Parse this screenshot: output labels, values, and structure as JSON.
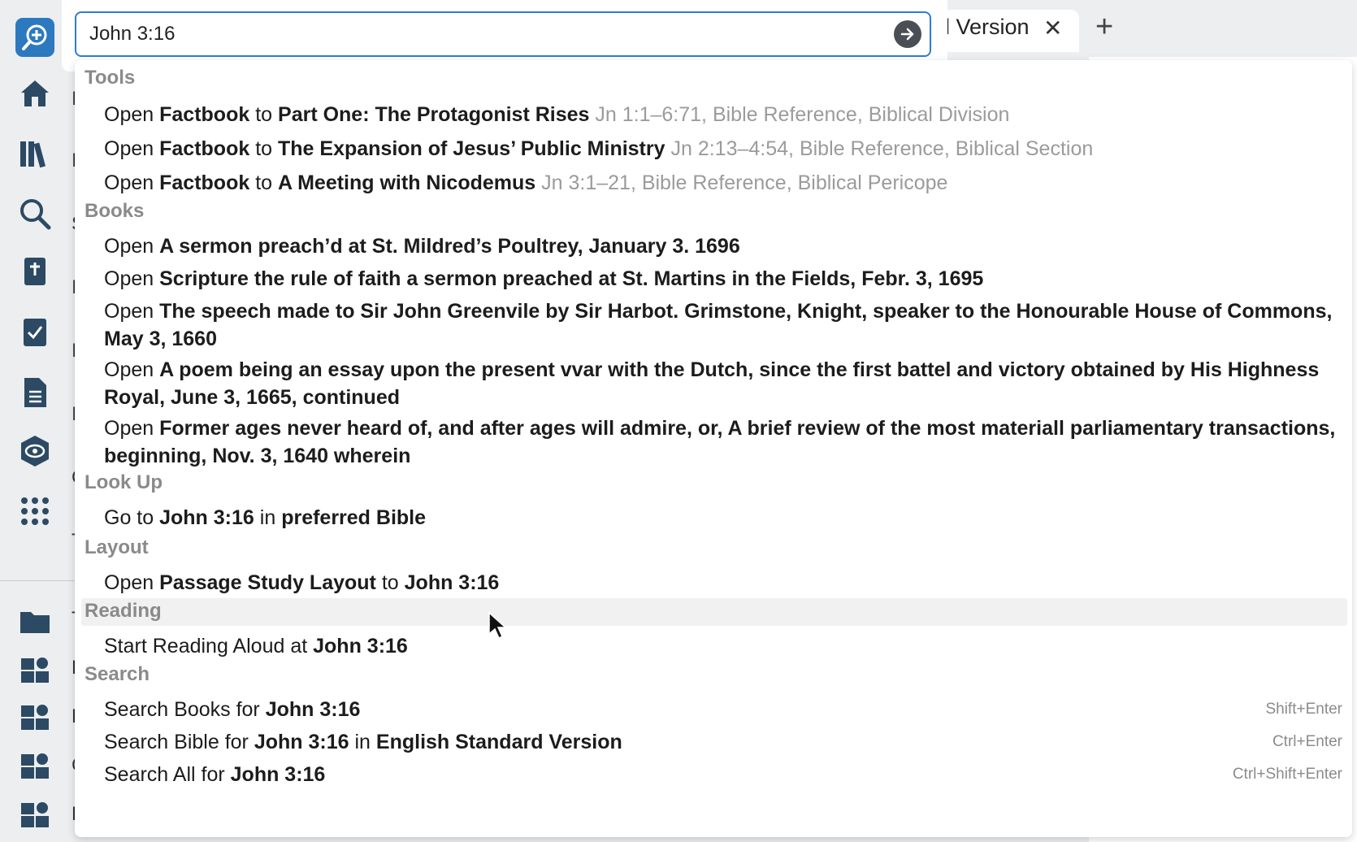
{
  "search": {
    "value": "John 3:16"
  },
  "tab": {
    "title": "l Version",
    "close": "✕",
    "add": "+"
  },
  "sections": {
    "tools": "Tools",
    "books": "Books",
    "lookup": "Look Up",
    "layout": "Layout",
    "reading": "Reading",
    "search": "Search"
  },
  "tools": [
    {
      "verb": "Open",
      "tool": "Factbook",
      "conj": "to",
      "target": "Part One: The Protagonist Rises",
      "meta": "Jn 1:1–6:71, Bible Reference, Biblical Division"
    },
    {
      "verb": "Open",
      "tool": "Factbook",
      "conj": "to",
      "target": "The Expansion of Jesus’ Public Ministry",
      "meta": "Jn 2:13–4:54, Bible Reference, Biblical Section"
    },
    {
      "verb": "Open",
      "tool": "Factbook",
      "conj": "to",
      "target": "A Meeting with Nicodemus",
      "meta": "Jn 3:1–21, Bible Reference, Biblical Pericope"
    }
  ],
  "books": [
    {
      "verb": "Open",
      "title": "A sermon preach’d at St. Mildred’s Poultrey, January 3. 1696"
    },
    {
      "verb": "Open",
      "title": "Scripture the rule of faith a sermon preached at St. Martins in the Fields, Febr. 3, 1695"
    },
    {
      "verb": "Open",
      "title": "The speech made to Sir John Greenvile by Sir Harbot. Grimstone, Knight, speaker to the Honourable House of Commons, May 3, 1660"
    },
    {
      "verb": "Open",
      "title": "A poem being an essay upon the present vvar with the Dutch, since the first battel and victory obtained by His Highness Royal, June 3, 1665, continued"
    },
    {
      "verb": "Open",
      "title": "Former ages never heard of, and after ages will admire, or, A brief review of the most materiall parliamentary transactions, beginning, Nov. 3, 1640 wherein"
    }
  ],
  "lookup": {
    "pre": "Go to",
    "ref": "John 3:16",
    "mid": "in",
    "bible": "preferred Bible"
  },
  "layout": {
    "verb": "Open",
    "name": "Passage Study Layout",
    "conj": "to",
    "ref": "John 3:16"
  },
  "reading": {
    "pre": "Start Reading Aloud at",
    "ref": "John 3:16"
  },
  "search_items": [
    {
      "pre": "Search Books for",
      "ref": "John 3:16",
      "mid": "",
      "version": "",
      "shortcut": "Shift+Enter"
    },
    {
      "pre": "Search Bible for",
      "ref": "John 3:16",
      "mid": "in",
      "version": "English Standard Version",
      "shortcut": "Ctrl+Enter"
    },
    {
      "pre": "Search All for",
      "ref": "John 3:16",
      "mid": "",
      "version": "",
      "shortcut": "Ctrl+Shift+Enter"
    }
  ],
  "rail_letters": [
    "I",
    "I",
    "S",
    "I",
    "I",
    "I",
    "C",
    "T",
    "T",
    "E",
    "E",
    "C",
    "F"
  ],
  "icons": [
    "logo-search-icon",
    "home-icon",
    "library-icon",
    "search-icon",
    "bible-icon",
    "checklist-icon",
    "document-icon",
    "eye-settings-icon",
    "apps-grid-icon",
    "folder-icon",
    "puzzle-gear-icon"
  ],
  "colors": {
    "accent": "#2f7bd6",
    "brand": "#2c79bf",
    "meta_text": "#9b9b9b",
    "section_header": "#8a8a8a",
    "highlight": "#f1f1f2"
  }
}
